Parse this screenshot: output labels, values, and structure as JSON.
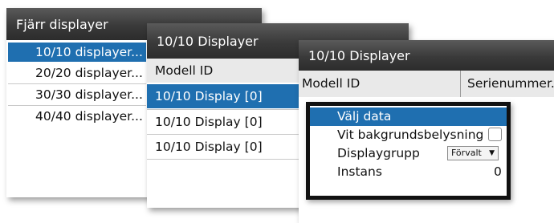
{
  "remote_displays": {
    "title": "Fjärr displayer",
    "items": [
      {
        "label": "10/10 displayer...",
        "selected": true
      },
      {
        "label": "20/20 displayer...",
        "selected": false
      },
      {
        "label": "30/30 displayer...",
        "selected": false
      },
      {
        "label": "40/40 displayer...",
        "selected": false
      }
    ]
  },
  "display_list": {
    "title": "10/10 Displayer",
    "column_header": "Modell ID",
    "rows": [
      {
        "label": "10/10 Display [0]",
        "selected": true
      },
      {
        "label": "10/10 Display [0]",
        "selected": false
      },
      {
        "label": "10/10 Display [0]",
        "selected": false
      }
    ]
  },
  "display_detail": {
    "title": "10/10 Displayer",
    "columns": [
      "Modell ID",
      "Serienummer."
    ]
  },
  "context_menu": {
    "items": [
      {
        "label": "Välj data",
        "selected": true
      },
      {
        "label": "Vit bakgrundsbelysning",
        "checked": false
      },
      {
        "label": "Displaygrupp",
        "dropdown_value": "Förvalt"
      },
      {
        "label": "Instans",
        "value": "0"
      }
    ]
  },
  "colors": {
    "selection": "#1f6fb0",
    "titlebar": "#3a3a3a",
    "popup_border": "#111111"
  },
  "icons": {
    "dropdown": "chevron-down-icon"
  }
}
